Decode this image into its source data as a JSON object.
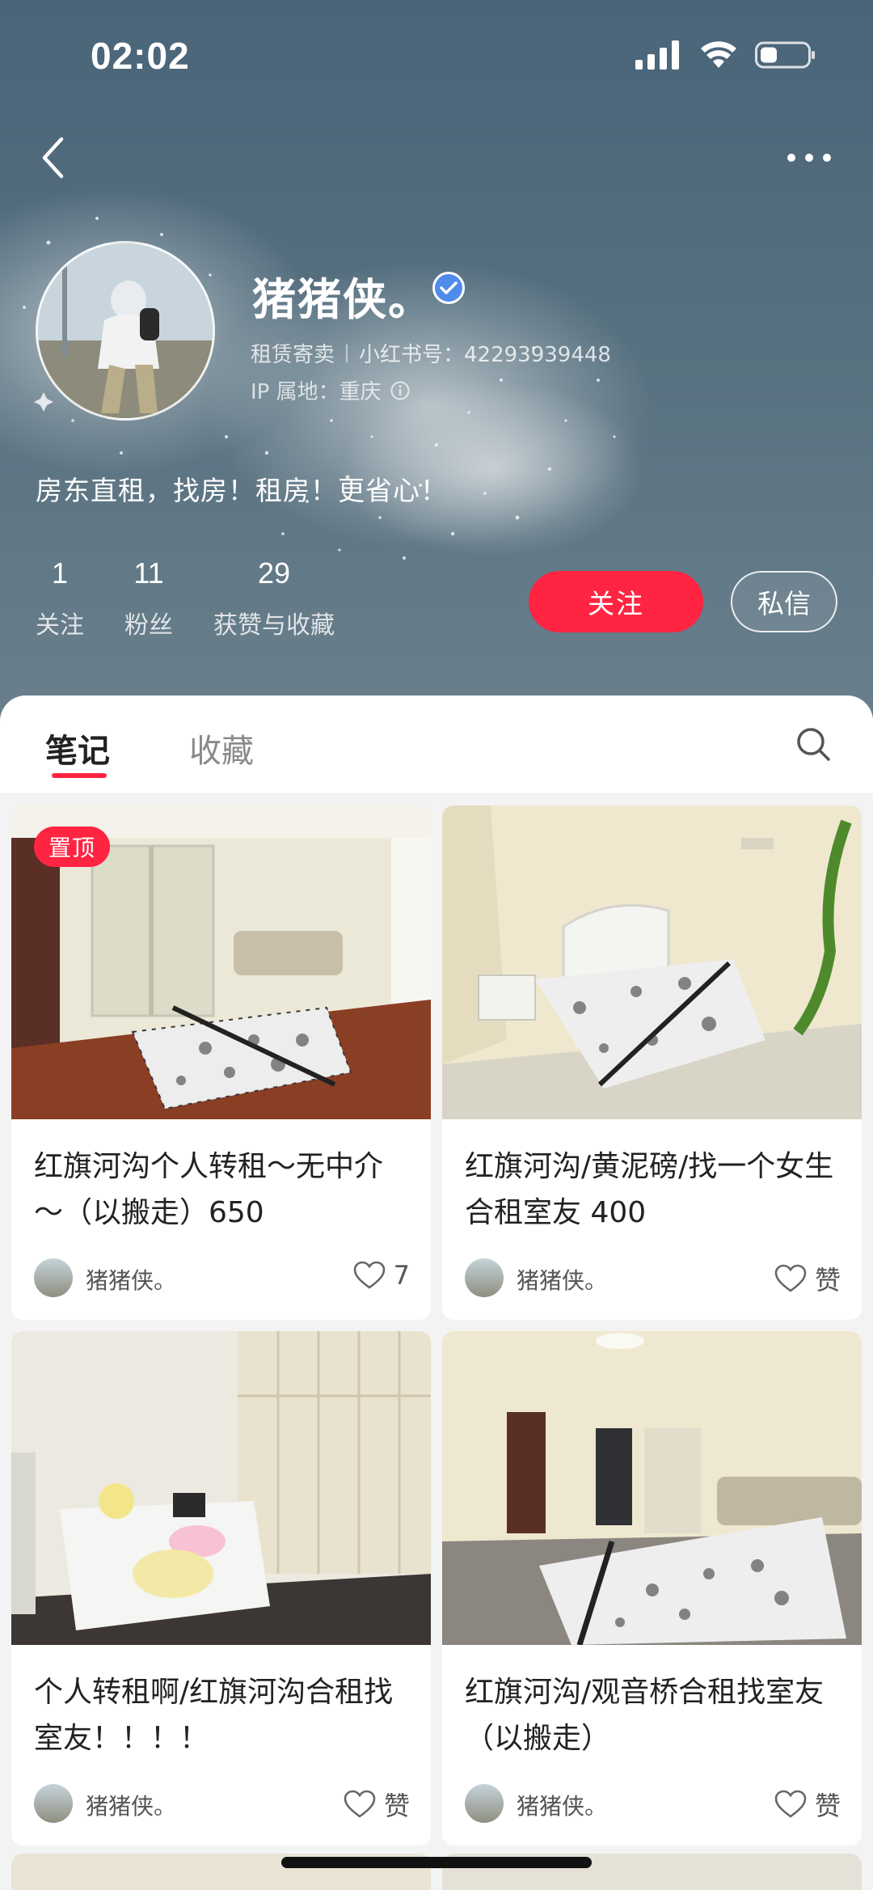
{
  "status_bar": {
    "time": "02:02"
  },
  "profile": {
    "name": "猪猪侠。",
    "category": "租赁寄卖",
    "red_id": "小红书号：4229393944​8",
    "ip_location": "IP 属地：重庆",
    "bio": "房东直租，找房！租房！更省心！",
    "stats": [
      {
        "value": "1",
        "label": "关注"
      },
      {
        "value": "11",
        "label": "粉丝"
      },
      {
        "value": "29",
        "label": "获赞与收藏"
      }
    ],
    "follow_label": "关注",
    "message_label": "私信"
  },
  "tabs": [
    {
      "label": "笔记",
      "active": true
    },
    {
      "label": "收藏",
      "active": false
    }
  ],
  "notes": [
    {
      "title": "红旗河沟个人转租～无中介～（以搬走）650",
      "author": "猪猪侠。",
      "likes": "7",
      "pinned": true,
      "pin_label": "置顶"
    },
    {
      "title": "红旗河沟/黄泥磅/找一个女生合租室友 400",
      "author": "猪猪侠。",
      "likes": "赞",
      "pinned": false
    },
    {
      "title": "个人转租啊/红旗河沟合租找室友！！！！",
      "author": "猪猪侠。",
      "likes": "赞",
      "pinned": false
    },
    {
      "title": "红旗河沟/观音桥合租找室友（以搬走）",
      "author": "猪猪侠。",
      "likes": "赞",
      "pinned": false
    }
  ],
  "colors": {
    "accent": "#ff2442",
    "verified": "#4f8bea",
    "header_bg": "#56707f"
  }
}
